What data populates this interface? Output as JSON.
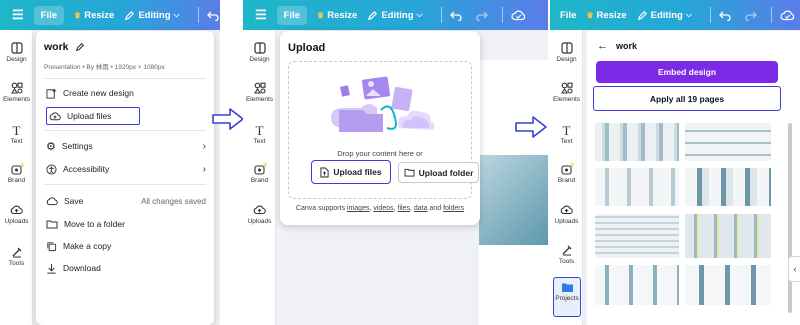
{
  "colors": {
    "topbar_gradient": [
      "#1fb6c8",
      "#26a6d8",
      "#5a7de8"
    ],
    "accent_purple": "#7d2ae8",
    "highlight_blue": "#3a3fd8",
    "crown": "#f7c948"
  },
  "topbar": {
    "file": "File",
    "resize": "Resize",
    "editing": "Editing"
  },
  "rail": {
    "design": "Design",
    "elements": "Elements",
    "text": "Text",
    "brand": "Brand",
    "uploads": "Uploads",
    "tools": "Tools",
    "projects": "Projects"
  },
  "file_menu": {
    "title": "work",
    "subtitle": "Presentation • By 林雨 • 1920px × 1080px",
    "create_new": "Create new design",
    "upload_files": "Upload files",
    "settings": "Settings",
    "accessibility": "Accessibility",
    "save": "Save",
    "save_status": "All changes saved",
    "move_to_folder": "Move to a folder",
    "make_copy": "Make a copy",
    "download": "Download"
  },
  "upload_panel": {
    "title": "Upload",
    "drop_text": "Drop your content here or",
    "upload_files": "Upload files",
    "upload_folder": "Upload folder",
    "supports_prefix": "Canva supports",
    "supports_images": "images",
    "supports_videos": "videos",
    "supports_files": "files",
    "supports_data": "data",
    "supports_and": "and",
    "supports_folders": "folders"
  },
  "projects_panel": {
    "back_title": "work",
    "embed_design": "Embed design",
    "apply_all": "Apply all 19 pages"
  },
  "icons": [
    "menu-icon",
    "crown-icon",
    "pencil-icon",
    "chevron-down-icon",
    "undo-icon",
    "redo-icon",
    "cloud-check-icon",
    "design-icon",
    "elements-icon",
    "text-icon",
    "brand-icon",
    "uploads-icon",
    "tools-icon",
    "folder-icon",
    "plus-file-icon",
    "cloud-upload-icon",
    "gear-icon",
    "accessibility-icon",
    "cloud-icon",
    "folder-move-icon",
    "copy-icon",
    "download-icon",
    "chevron-right-icon",
    "arrow-right-icon",
    "back-arrow-icon",
    "chevron-left-icon"
  ]
}
